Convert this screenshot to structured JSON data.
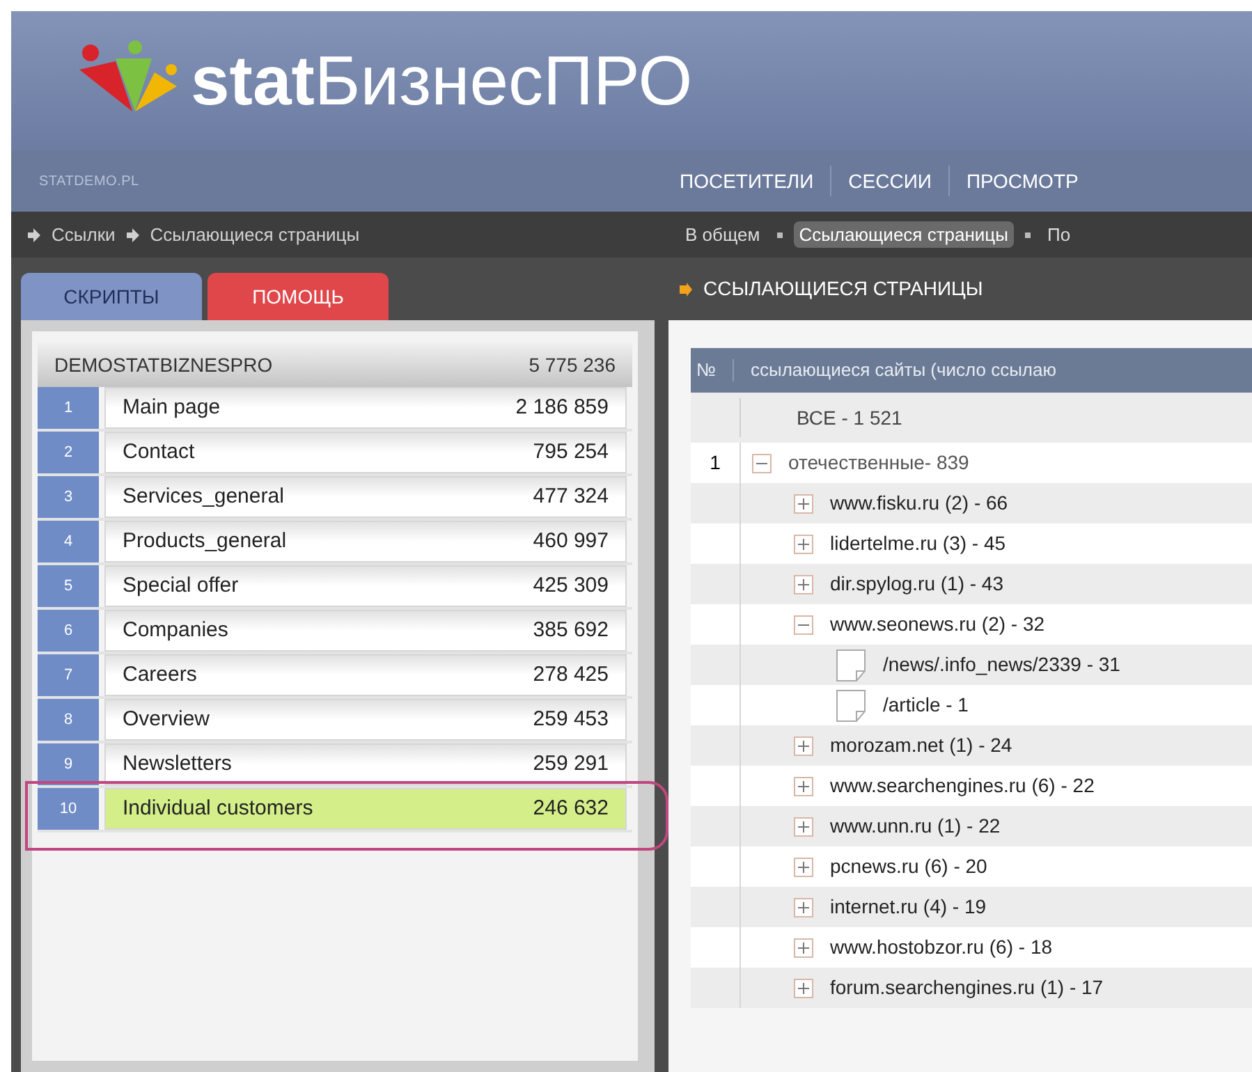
{
  "logo": {
    "text": "**stat**БизнесПРО"
  },
  "site": "STATDEMO.PL",
  "nav": [
    "ПОСЕТИТЕЛИ",
    "СЕССИИ",
    "ПРОСМОТР"
  ],
  "breadcrumb": [
    "Ссылки",
    "Ссылающиеся страницы"
  ],
  "subnav": [
    {
      "label": "В общем",
      "selected": false
    },
    {
      "label": "Ссылающиеся страницы",
      "selected": true
    },
    {
      "label": "По",
      "selected": false
    }
  ],
  "tabs": [
    {
      "label": "СКРИПТЫ",
      "selected": true,
      "color": "#7f94c4"
    },
    {
      "label": "ПОМОЩЬ",
      "selected": false,
      "color": "#e0474a"
    }
  ],
  "scripts_table": {
    "title": "DEMOSTATBIZNESPRO",
    "total": "5 775 236",
    "rows": [
      {
        "number": "1",
        "name": "Main page",
        "value": "2 186 859",
        "selected": false
      },
      {
        "number": "2",
        "name": "Contact",
        "value": "795 254",
        "selected": false
      },
      {
        "number": "3",
        "name": "Services_general",
        "value": "477 324",
        "selected": false
      },
      {
        "number": "4",
        "name": "Products_general",
        "value": "460 997",
        "selected": false
      },
      {
        "number": "5",
        "name": "Special offer",
        "value": "425 309",
        "selected": false
      },
      {
        "number": "6",
        "name": "Companies",
        "value": "385 692",
        "selected": false
      },
      {
        "number": "7",
        "name": "Careers",
        "value": "278 425",
        "selected": false
      },
      {
        "number": "8",
        "name": "Overview",
        "value": "259 453",
        "selected": false
      },
      {
        "number": "9",
        "name": "Newsletters",
        "value": "259 291",
        "selected": false
      },
      {
        "number": "10",
        "name": "Individual customers",
        "value": "246 632",
        "selected": true
      }
    ]
  },
  "referrers": {
    "title": "ССЫЛАЮЩИЕСЯ СТРАНИЦЫ",
    "columns": [
      "№",
      "ссылающиеся сайты (число ссылаю"
    ],
    "all_row": "ВСЕ - 1 521",
    "tree": [
      {
        "kind": "group",
        "number": "1",
        "label": "отечественные- 839",
        "expanded": true,
        "children": [
          {
            "kind": "site",
            "label": "www.fisku.ru (2) - 66",
            "expanded": false
          },
          {
            "kind": "site",
            "label": "lidertelme.ru (3) - 45",
            "expanded": false
          },
          {
            "kind": "site",
            "label": "dir.spylog.ru (1) - 43",
            "expanded": false
          },
          {
            "kind": "site",
            "label": "www.seonews.ru (2) - 32",
            "expanded": true,
            "children": [
              {
                "kind": "page",
                "label": "/news/.info_news/2339 - 31"
              },
              {
                "kind": "page",
                "label": "/article - 1"
              }
            ]
          },
          {
            "kind": "site",
            "label": "morozam.net (1) - 24",
            "expanded": false
          },
          {
            "kind": "site",
            "label": "www.searchengines.ru (6) - 22",
            "expanded": false
          },
          {
            "kind": "site",
            "label": "www.unn.ru (1) - 22",
            "expanded": false
          },
          {
            "kind": "site",
            "label": "pcnews.ru (6) - 20",
            "expanded": false
          },
          {
            "kind": "site",
            "label": "internet.ru (4) - 19",
            "expanded": false
          },
          {
            "kind": "site",
            "label": "www.hostobzor.ru (6) - 18",
            "expanded": false
          },
          {
            "kind": "site",
            "label": "forum.searchengines.ru (1) - 17",
            "expanded": false
          }
        ]
      }
    ]
  }
}
